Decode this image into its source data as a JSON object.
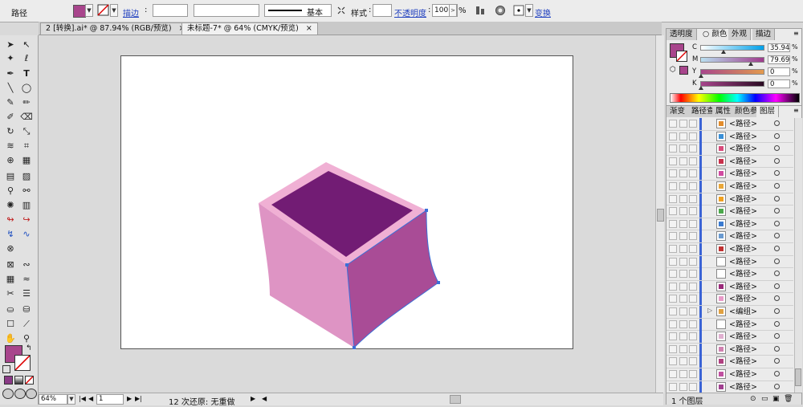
{
  "control_bar": {
    "selection_type": "路径",
    "fill_color": "#a8458c",
    "stroke_label": "描边",
    "stroke_style": "基本",
    "style_label": "样式",
    "opacity_label": "不透明度",
    "opacity_value": "100",
    "opacity_unit": "%",
    "transform_label": "变换"
  },
  "tabs": [
    {
      "label": "2 [转换].ai* @ 87.94% (RGB/预览)"
    },
    {
      "label": "未标题-7* @ 64% (CMYK/预览)"
    }
  ],
  "color_panel": {
    "tabs": [
      "透明度",
      "颜色",
      "外观",
      "描边"
    ],
    "channels": [
      {
        "name": "C",
        "value": "35.94",
        "fraction": 0.36,
        "gradient": "linear-gradient(to right,#ffffff,#00a0e9)"
      },
      {
        "name": "M",
        "value": "79.69",
        "fraction": 0.8,
        "gradient": "linear-gradient(to right,#b9dff0,#9e3a8c)"
      },
      {
        "name": "Y",
        "value": "0",
        "fraction": 0.0,
        "gradient": "linear-gradient(to right,#a8458c,#e39a4d)"
      },
      {
        "name": "K",
        "value": "0",
        "fraction": 0.0,
        "gradient": "linear-gradient(to right,#a8458c,#2a0a22)"
      }
    ],
    "fill_color": "#a8458c"
  },
  "layers_panel": {
    "tabs": [
      "渐变",
      "路径查",
      "属性",
      "颜色参",
      "图层"
    ],
    "rows": [
      {
        "name": "<路径>",
        "icon": "#e28c2c"
      },
      {
        "name": "<路径>",
        "icon": "#3a8fd6"
      },
      {
        "name": "<路径>",
        "icon": "#d84a7a"
      },
      {
        "name": "<路径>",
        "icon": "#c82f4a"
      },
      {
        "name": "<路径>",
        "icon": "#d04aa0"
      },
      {
        "name": "<路径>",
        "icon": "#e9a73a"
      },
      {
        "name": "<路径>",
        "icon": "#f0a020"
      },
      {
        "name": "<路径>",
        "icon": "#4aa84a"
      },
      {
        "name": "<路径>",
        "icon": "#3a7ad0"
      },
      {
        "name": "<路径>",
        "icon": "#6a9ad0"
      },
      {
        "name": "<路径>",
        "icon": "#c03030"
      },
      {
        "name": "<路径>",
        "icon": "#ffffff"
      },
      {
        "name": "<路径>",
        "icon": "#ffffff"
      },
      {
        "name": "<路径>",
        "icon": "#9a2a7a"
      },
      {
        "name": "<路径>",
        "icon": "#e89ac8"
      },
      {
        "name": "<编组>",
        "icon": "#e0a040"
      },
      {
        "name": "<路径>",
        "icon": "#ffffff"
      },
      {
        "name": "<路径>",
        "icon": "#e0b0d0"
      },
      {
        "name": "<路径>",
        "icon": "#d080b0"
      },
      {
        "name": "<路径>",
        "icon": "#b04080"
      },
      {
        "name": "<路径>",
        "icon": "#c050a0"
      },
      {
        "name": "<路径>",
        "icon": "#a04090"
      }
    ],
    "footer": "1 个图层"
  },
  "status_bar": {
    "zoom": "64%",
    "page": "1",
    "status_text": "12 次还原: 无重做"
  },
  "artwork": {
    "top_face": "#f0b0d4",
    "top_inner": "#721c74",
    "left_face": "#de94c4",
    "right_face": "#a94c96",
    "path_color": "#3a6fd8"
  }
}
